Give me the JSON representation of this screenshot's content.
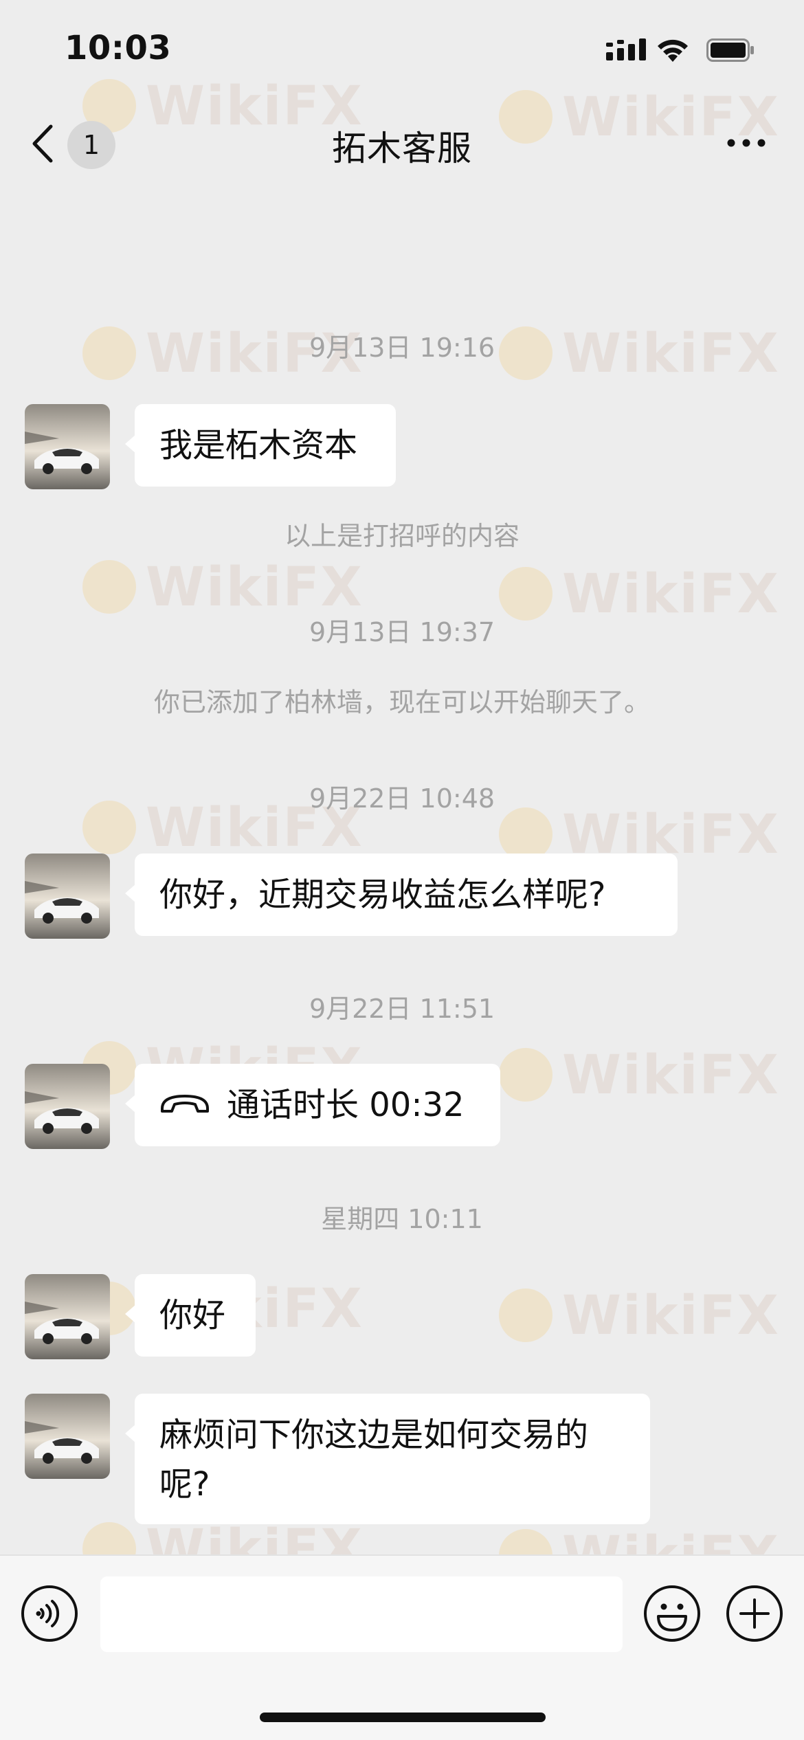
{
  "status_bar": {
    "time": "10:03"
  },
  "nav": {
    "unread_count": "1",
    "title": "拓木客服"
  },
  "watermark_text": "WikiFX",
  "messages": [
    {
      "type": "timestamp",
      "text": "9月13日 19:16"
    },
    {
      "type": "incoming",
      "text": "我是柘木资本"
    },
    {
      "type": "system",
      "text": "以上是打招呼的内容"
    },
    {
      "type": "timestamp",
      "text": "9月13日 19:37"
    },
    {
      "type": "system",
      "text": "你已添加了柏林墙，现在可以开始聊天了。"
    },
    {
      "type": "timestamp",
      "text": "9月22日 10:48"
    },
    {
      "type": "incoming",
      "text": "你好，近期交易收益怎么样呢?"
    },
    {
      "type": "timestamp",
      "text": "9月22日 11:51"
    },
    {
      "type": "call",
      "text": "通话时长 00:32",
      "icon": "phone-hangup-icon"
    },
    {
      "type": "timestamp",
      "text": "星期四 10:11"
    },
    {
      "type": "incoming",
      "text": "你好"
    },
    {
      "type": "incoming",
      "line1": "麻烦问下你这边是如何交易的",
      "line2": "呢?"
    }
  ],
  "input_bar": {
    "voice_icon": "voice-icon",
    "emoji_icon": "emoji-icon",
    "plus_icon": "plus-icon",
    "input_value": ""
  }
}
